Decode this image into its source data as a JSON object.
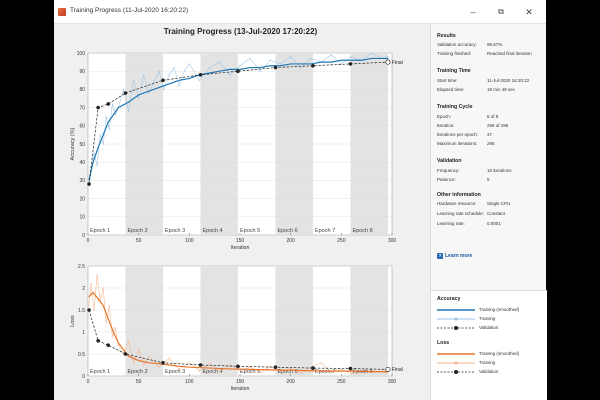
{
  "window": {
    "title": "Training Progress (11-Jul-2020 16:20:22)",
    "min_glyph": "–",
    "max_glyph": "⧉",
    "close_glyph": "✕"
  },
  "main_title": "Training Progress (13-Jul-2020 17:20:22)",
  "colors": {
    "training_acc_smoothed": "#1f77b4",
    "training_acc": "#9cc3e6",
    "training_loss_smoothed": "#e8742a",
    "training_loss": "#f5b38a",
    "validation": "#222222",
    "epoch_shade": "#e3e3e3"
  },
  "epochs": [
    "Epoch 1",
    "Epoch 2",
    "Epoch 3",
    "Epoch 4",
    "Epoch 5",
    "Epoch 6",
    "Epoch 7",
    "Epoch 8"
  ],
  "final_label": "Final",
  "chart_data": [
    {
      "type": "line",
      "ylabel": "Accuracy (%)",
      "xlabel": "Iteration",
      "xlim": [
        0,
        300
      ],
      "ylim": [
        0,
        100
      ],
      "xticks": [
        0,
        50,
        100,
        150,
        200,
        250,
        300
      ],
      "yticks": [
        0,
        10,
        20,
        30,
        40,
        50,
        60,
        70,
        80,
        90,
        100
      ],
      "series": [
        {
          "name": "Training (smoothed)",
          "x": [
            1,
            5,
            10,
            15,
            20,
            30,
            40,
            50,
            60,
            70,
            80,
            90,
            100,
            110,
            120,
            130,
            140,
            150,
            160,
            170,
            180,
            190,
            200,
            210,
            220,
            230,
            240,
            250,
            260,
            270,
            280,
            290,
            296
          ],
          "values": [
            30,
            40,
            48,
            55,
            62,
            70,
            73,
            77,
            79,
            81,
            83,
            85,
            86,
            88,
            89,
            90,
            91,
            91,
            92,
            92,
            93,
            93,
            94,
            94,
            94,
            95,
            95,
            96,
            96,
            96,
            97,
            97,
            97
          ]
        },
        {
          "name": "Training",
          "x": [
            1,
            3,
            6,
            9,
            12,
            15,
            18,
            21,
            24,
            27,
            30,
            35,
            40,
            45,
            50,
            55,
            60,
            65,
            70,
            75,
            80,
            85,
            90,
            95,
            100,
            110,
            120,
            130,
            140,
            150,
            160,
            170,
            180,
            190,
            200,
            210,
            220,
            230,
            240,
            250,
            260,
            270,
            280,
            290,
            296
          ],
          "values": [
            28,
            35,
            45,
            38,
            55,
            50,
            65,
            58,
            72,
            66,
            70,
            80,
            68,
            85,
            75,
            88,
            78,
            84,
            90,
            80,
            88,
            92,
            82,
            90,
            94,
            85,
            92,
            95,
            88,
            93,
            97,
            90,
            96,
            94,
            98,
            92,
            97,
            95,
            99,
            94,
            98,
            96,
            100,
            97,
            98
          ]
        },
        {
          "name": "Validation",
          "x": [
            1,
            10,
            20,
            37,
            74,
            111,
            148,
            185,
            222,
            259,
            296
          ],
          "values": [
            28,
            70,
            72,
            78,
            85,
            88,
            90,
            92,
            93,
            94,
            95
          ]
        }
      ]
    },
    {
      "type": "line",
      "ylabel": "Loss",
      "xlabel": "Iteration",
      "xlim": [
        0,
        300
      ],
      "ylim": [
        0,
        2.5
      ],
      "xticks": [
        0,
        50,
        100,
        150,
        200,
        250,
        300
      ],
      "yticks": [
        0,
        0.5,
        1,
        1.5,
        2,
        2.5
      ],
      "series": [
        {
          "name": "Training (smoothed)",
          "x": [
            1,
            5,
            10,
            15,
            20,
            25,
            30,
            35,
            40,
            50,
            60,
            70,
            80,
            90,
            100,
            120,
            140,
            160,
            180,
            200,
            220,
            240,
            260,
            280,
            296
          ],
          "values": [
            1.8,
            1.9,
            1.75,
            1.6,
            1.3,
            1.0,
            0.75,
            0.6,
            0.45,
            0.35,
            0.3,
            0.28,
            0.25,
            0.22,
            0.2,
            0.18,
            0.16,
            0.15,
            0.14,
            0.13,
            0.12,
            0.11,
            0.11,
            0.1,
            0.1
          ]
        },
        {
          "name": "Training",
          "x": [
            1,
            3,
            6,
            9,
            12,
            15,
            18,
            21,
            24,
            27,
            30,
            35,
            40,
            45,
            50,
            55,
            60,
            70,
            80,
            90,
            100,
            110,
            120,
            130,
            140,
            150,
            160,
            170,
            180,
            190,
            200,
            210,
            220,
            230,
            240,
            250,
            260,
            270,
            280,
            290,
            296
          ],
          "values": [
            1.6,
            2.1,
            1.5,
            2.3,
            1.7,
            2.0,
            1.2,
            1.6,
            0.9,
            1.1,
            0.7,
            0.5,
            0.8,
            0.3,
            0.6,
            0.25,
            0.45,
            0.2,
            0.4,
            0.15,
            0.3,
            0.12,
            0.28,
            0.1,
            0.25,
            0.12,
            0.2,
            0.08,
            0.22,
            0.1,
            0.18,
            0.06,
            0.2,
            0.3,
            0.08,
            0.15,
            0.05,
            0.12,
            0.08,
            0.1,
            0.06
          ]
        },
        {
          "name": "Validation",
          "x": [
            1,
            10,
            20,
            37,
            74,
            111,
            148,
            185,
            222,
            259,
            296
          ],
          "values": [
            1.5,
            0.8,
            0.7,
            0.5,
            0.3,
            0.25,
            0.22,
            0.2,
            0.18,
            0.17,
            0.15
          ]
        }
      ]
    }
  ],
  "sidebar": {
    "results": {
      "title": "Results",
      "rows": [
        {
          "k": "Validation accuracy:",
          "v": "96.67%"
        },
        {
          "k": "Training finished:",
          "v": "Reached final iteration"
        }
      ]
    },
    "training_time": {
      "title": "Training Time",
      "rows": [
        {
          "k": "Start time:",
          "v": "11-Jul-2020 16:20:22"
        },
        {
          "k": "Elapsed time:",
          "v": "19 min 48 sec"
        }
      ]
    },
    "training_cycle": {
      "title": "Training Cycle",
      "rows": [
        {
          "k": "Epoch:",
          "v": "8 of 8"
        },
        {
          "k": "Iteration:",
          "v": "296 of 296"
        },
        {
          "k": "Iterations per epoch:",
          "v": "37"
        },
        {
          "k": "Maximum iterations:",
          "v": "296"
        }
      ]
    },
    "validation": {
      "title": "Validation",
      "rows": [
        {
          "k": "Frequency:",
          "v": "10 iterations"
        },
        {
          "k": "Patience:",
          "v": "5"
        }
      ]
    },
    "other": {
      "title": "Other information",
      "rows": [
        {
          "k": "Hardware resource:",
          "v": "Single CPU"
        },
        {
          "k": "Learning rate schedule:",
          "v": "Constant"
        },
        {
          "k": "Learning rate:",
          "v": "0.0001"
        }
      ]
    },
    "learn_more": "Learn more"
  },
  "legend": {
    "accuracy": {
      "title": "Accuracy",
      "items": [
        "Training (smoothed)",
        "Training",
        "Validation"
      ]
    },
    "loss": {
      "title": "Loss",
      "items": [
        "Training (smoothed)",
        "Training",
        "Validation"
      ]
    }
  }
}
